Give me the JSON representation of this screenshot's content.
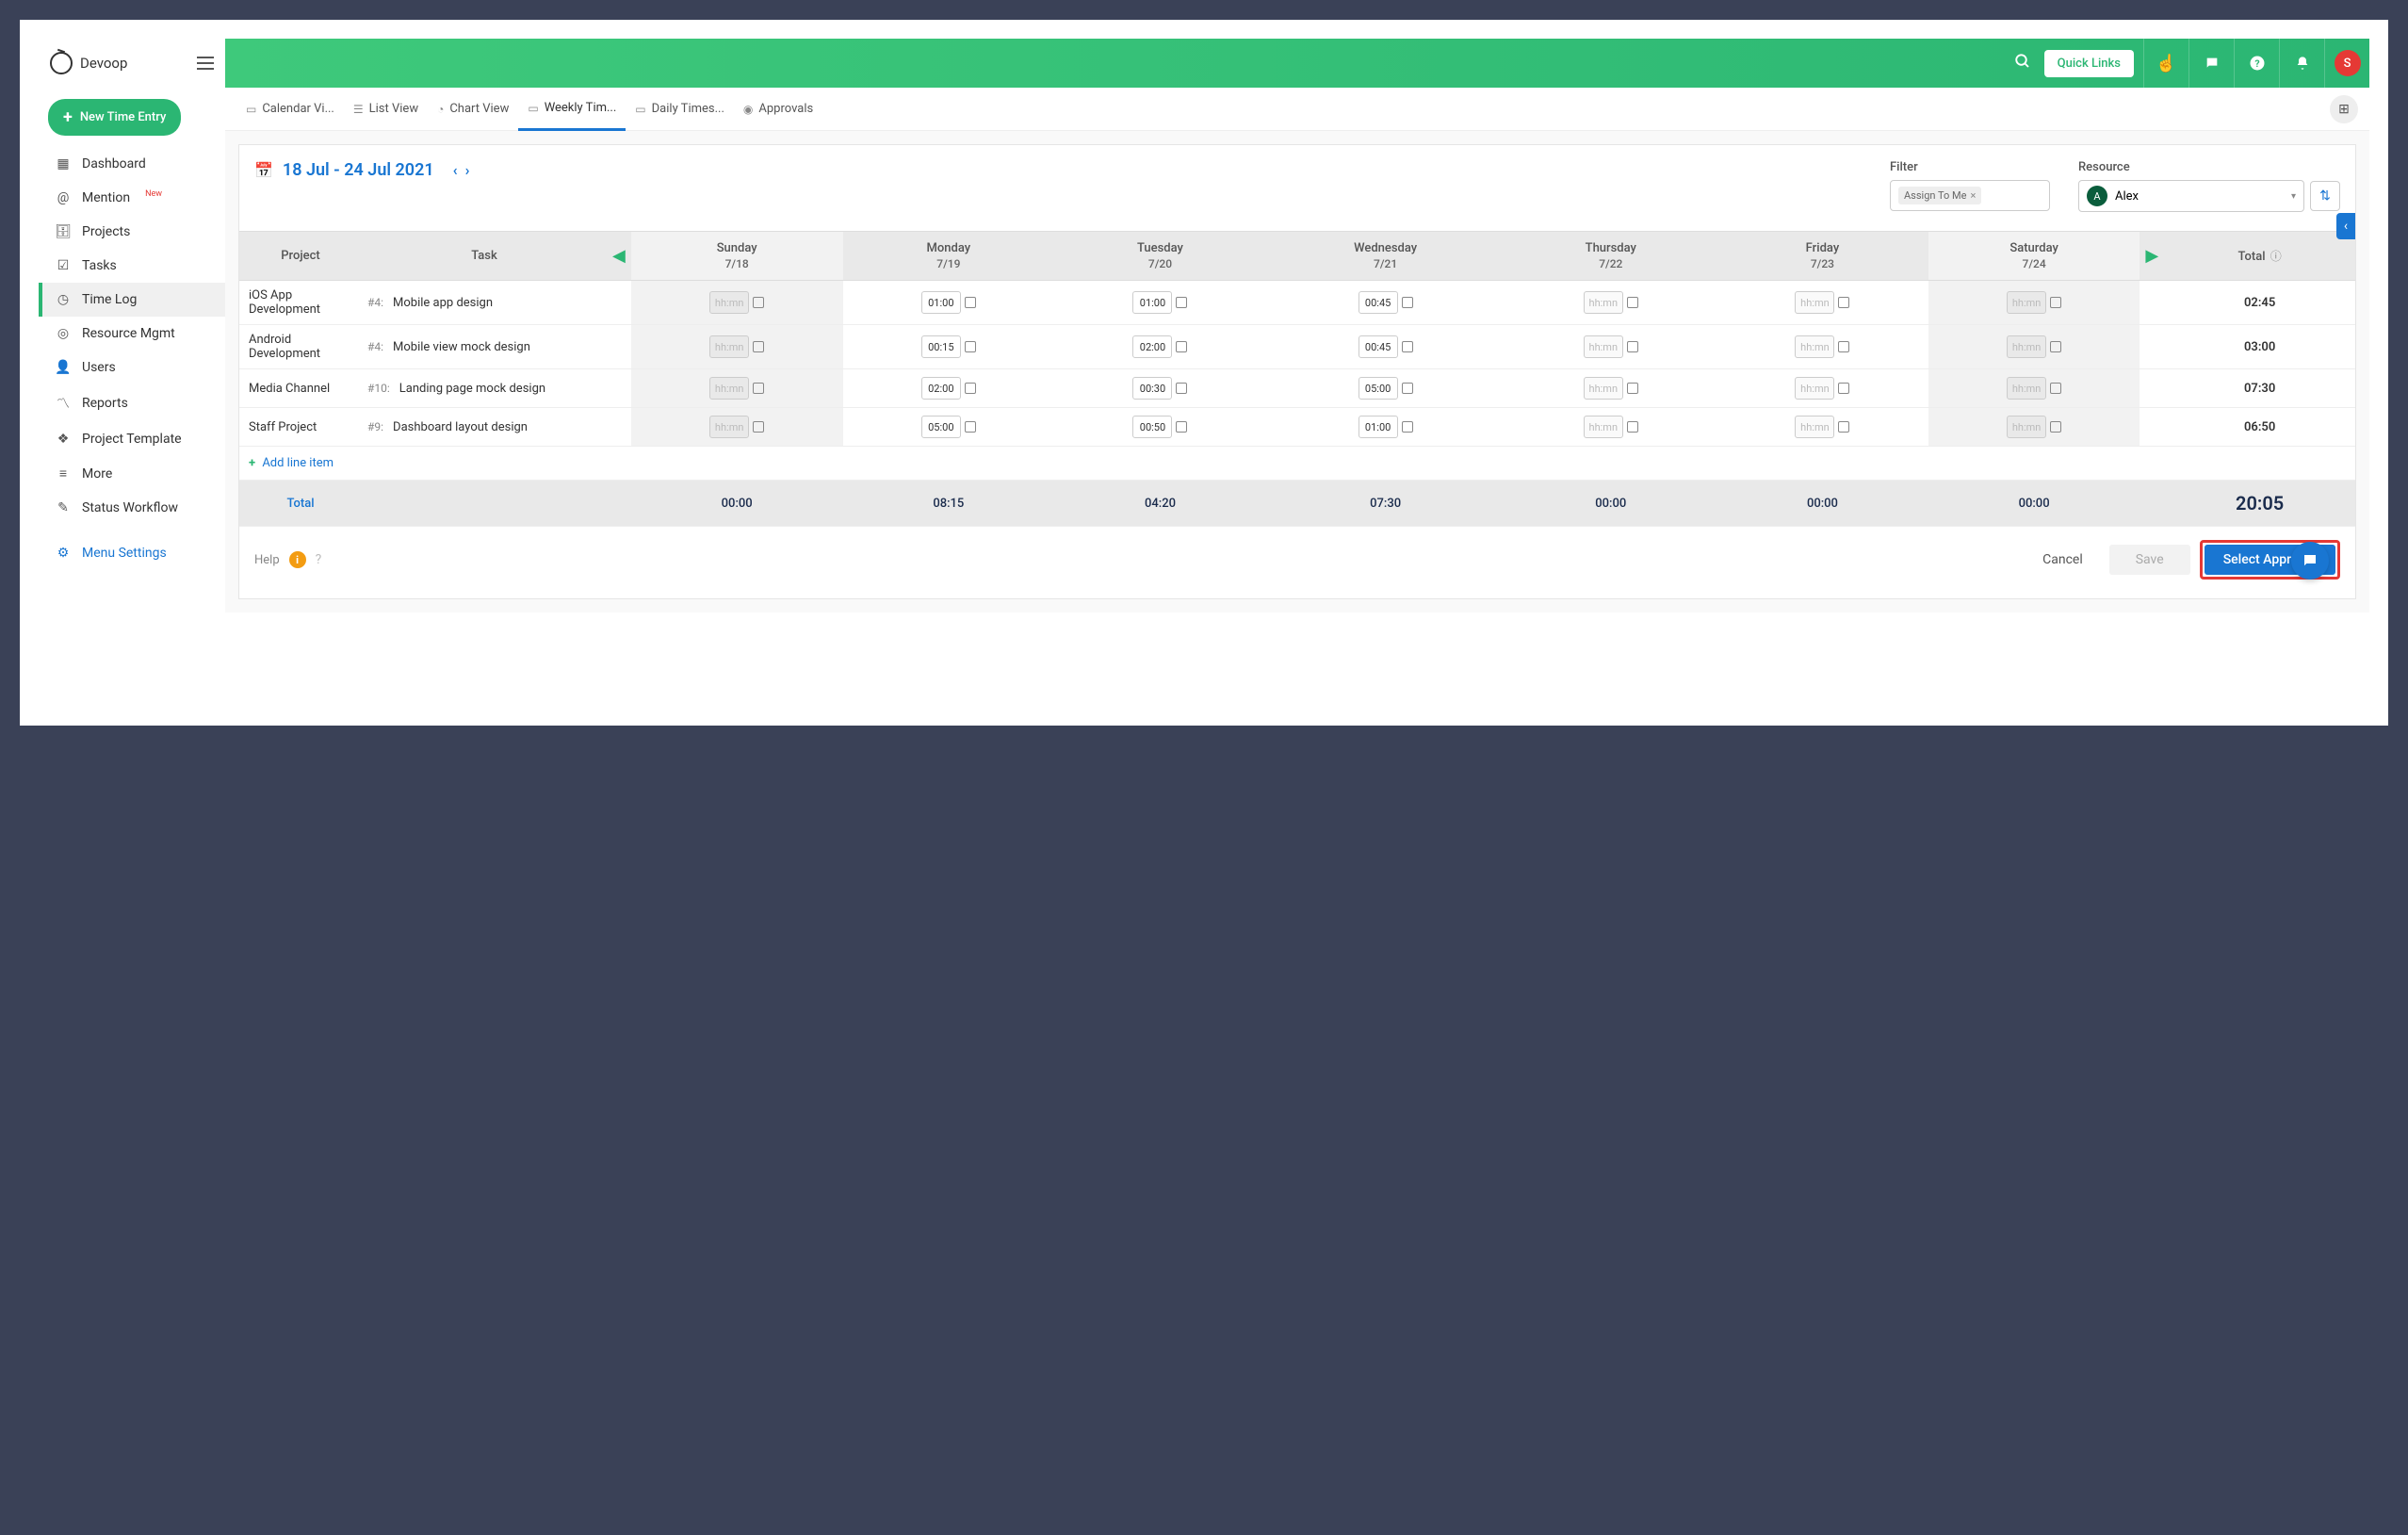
{
  "app": {
    "name": "Devoop"
  },
  "header": {
    "quick_links": "Quick Links",
    "avatar_initial": "S"
  },
  "sidebar": {
    "new_entry": "New Time Entry",
    "items": [
      {
        "label": "Dashboard",
        "icon": "▦"
      },
      {
        "label": "Mention",
        "icon": "@",
        "badge": "New"
      },
      {
        "label": "Projects",
        "icon": "🗄"
      },
      {
        "label": "Tasks",
        "icon": "☑"
      },
      {
        "label": "Time Log",
        "icon": "◷",
        "active": true
      },
      {
        "label": "Resource Mgmt",
        "icon": "◎"
      },
      {
        "label": "Users",
        "icon": "👤"
      },
      {
        "label": "Reports",
        "icon": "〽"
      },
      {
        "label": "Project Template",
        "icon": "❖"
      },
      {
        "label": "More",
        "icon": "≡"
      },
      {
        "label": "Status Workflow",
        "icon": "✎"
      }
    ],
    "settings": "Menu Settings"
  },
  "tabs": [
    {
      "label": "Calendar Vi...",
      "icon": "▭"
    },
    {
      "label": "List View",
      "icon": "☰"
    },
    {
      "label": "Chart View",
      "icon": "◔"
    },
    {
      "label": "Weekly Tim...",
      "icon": "▭",
      "active": true
    },
    {
      "label": "Daily Times...",
      "icon": "▭"
    },
    {
      "label": "Approvals",
      "icon": "◉"
    }
  ],
  "date_range": "18 Jul - 24 Jul 2021",
  "filter": {
    "label": "Filter",
    "chip": "Assign To Me"
  },
  "resource": {
    "label": "Resource",
    "initial": "A",
    "name": "Alex"
  },
  "columns": {
    "project": "Project",
    "task": "Task",
    "total": "Total",
    "days": [
      {
        "day": "Sunday",
        "date": "7/18"
      },
      {
        "day": "Monday",
        "date": "7/19"
      },
      {
        "day": "Tuesday",
        "date": "7/20"
      },
      {
        "day": "Wednesday",
        "date": "7/21"
      },
      {
        "day": "Thursday",
        "date": "7/22"
      },
      {
        "day": "Friday",
        "date": "7/23"
      },
      {
        "day": "Saturday",
        "date": "7/24"
      }
    ]
  },
  "placeholder": "hh:mn",
  "rows": [
    {
      "project": "iOS App Development",
      "task_num": "#4:",
      "task": "Mobile app design",
      "times": [
        "",
        "01:00",
        "01:00",
        "00:45",
        "",
        "",
        ""
      ],
      "total": "02:45"
    },
    {
      "project": "Android Development",
      "task_num": "#4:",
      "task": "Mobile view mock design",
      "times": [
        "",
        "00:15",
        "02:00",
        "00:45",
        "",
        "",
        ""
      ],
      "total": "03:00"
    },
    {
      "project": "Media Channel",
      "task_num": "#10:",
      "task": "Landing page mock design",
      "times": [
        "",
        "02:00",
        "00:30",
        "05:00",
        "",
        "",
        ""
      ],
      "total": "07:30"
    },
    {
      "project": "Staff Project",
      "task_num": "#9:",
      "task": "Dashboard layout design",
      "times": [
        "",
        "05:00",
        "00:50",
        "01:00",
        "",
        "",
        ""
      ],
      "total": "06:50"
    }
  ],
  "add_line": "Add line item",
  "totals": {
    "label": "Total",
    "days": [
      "00:00",
      "08:15",
      "04:20",
      "07:30",
      "00:00",
      "00:00",
      "00:00"
    ],
    "grand": "20:05"
  },
  "footer": {
    "help": "Help",
    "cancel": "Cancel",
    "save": "Save",
    "approver": "Select Approver"
  }
}
